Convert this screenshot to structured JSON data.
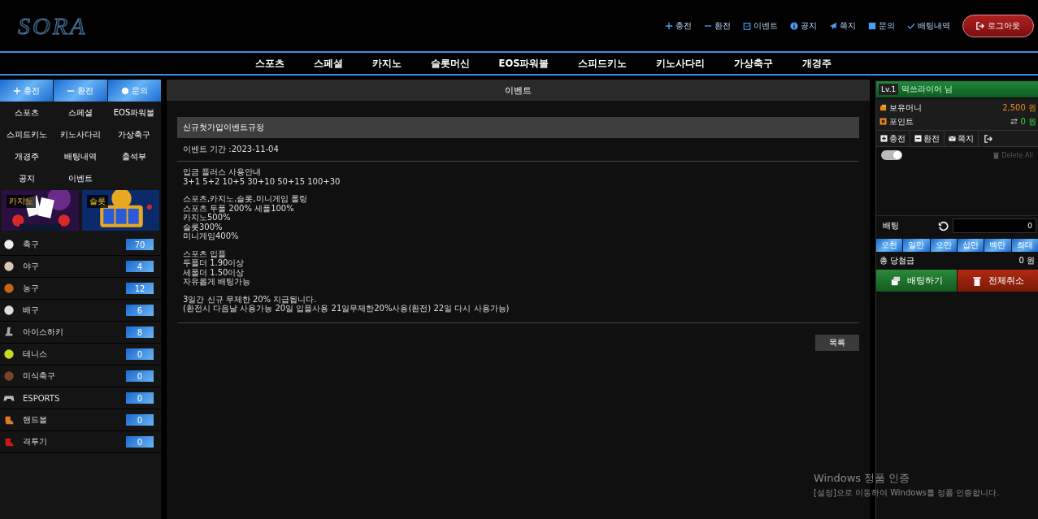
{
  "header": {
    "logo": "SORA",
    "links": [
      {
        "label": "충전"
      },
      {
        "label": "환전"
      },
      {
        "label": "이벤트"
      },
      {
        "label": "공지"
      },
      {
        "label": "쪽지"
      },
      {
        "label": "문의"
      },
      {
        "label": "배팅내역"
      }
    ],
    "logout": "로그아웃"
  },
  "nav": [
    "스포츠",
    "스페셜",
    "카지노",
    "슬롯머신",
    "EOS파워볼",
    "스피드키노",
    "키노사다리",
    "가상축구",
    "개경주"
  ],
  "sidebar": {
    "top_buttons": [
      "충전",
      "환전",
      "문의"
    ],
    "menu": [
      "스포츠",
      "스페셜",
      "EOS파워볼",
      "스피드키노",
      "키노사다리",
      "가상축구",
      "개경주",
      "배팅내역",
      "출석부",
      "공지",
      "이벤트"
    ],
    "banners": [
      {
        "label": "카지노",
        "kind": "picture"
      },
      {
        "label": "슬롯",
        "kind": "picture"
      }
    ],
    "sports": [
      {
        "name": "축구",
        "count": "70"
      },
      {
        "name": "야구",
        "count": "4"
      },
      {
        "name": "농구",
        "count": "12"
      },
      {
        "name": "배구",
        "count": "6"
      },
      {
        "name": "아이스하키",
        "count": "8"
      },
      {
        "name": "테니스",
        "count": "0"
      },
      {
        "name": "미식축구",
        "count": "0"
      },
      {
        "name": "ESPORTS",
        "count": "0"
      },
      {
        "name": "핸드볼",
        "count": "0"
      },
      {
        "name": "격투기",
        "count": "0"
      }
    ]
  },
  "main": {
    "title": "이벤트",
    "article": {
      "title": "신규첫가입이벤트규정",
      "period": "이벤트 기간 :2023-11-04",
      "paragraphs": [
        [
          "입금 플러스 사용안내",
          "3+1 5+2 10+5 30+10 50+15 100+30"
        ],
        [
          "스포츠,카지노,슬롯,미니게임 롤링",
          "스포츠 두폴 200% 세폴100%",
          "카지노500%",
          "슬롯300%",
          "미니게임400%"
        ],
        [
          "스포츠 입플",
          "두폴더 1.90이상",
          "세폴더 1.50이상",
          "자유롭게 배팅가능"
        ],
        [
          "3일간 신규 무제한 20% 지급됩니다.",
          "(환전시 다음날 사용가능 20일 입플사용 21일무제한20%사용(환전) 22일 다시 사용가능)"
        ]
      ],
      "list_button": "목록"
    }
  },
  "betslip": {
    "level": "Lv.1",
    "user": "먹쓰라이어 님",
    "money_label": "보유머니",
    "money": "2,500 원",
    "point_label": "포인트",
    "point": "0 원",
    "tabs": [
      "충전",
      "환전",
      "쪽지"
    ],
    "toggle_on": true,
    "delete_all": "Delete All",
    "bet_label": "배팅",
    "bet_value": "0",
    "chips": [
      "오천",
      "일만",
      "오만",
      "십만",
      "백만",
      "최대"
    ],
    "win_label": "총 당첨금",
    "win": "0 원",
    "bet_button": "배팅하기",
    "cancel_button": "전체취소"
  },
  "os_notice": {
    "title": "Windows 정품 인증",
    "text": "[설정]으로 이동하여 Windows를 정품 인증합니다."
  }
}
